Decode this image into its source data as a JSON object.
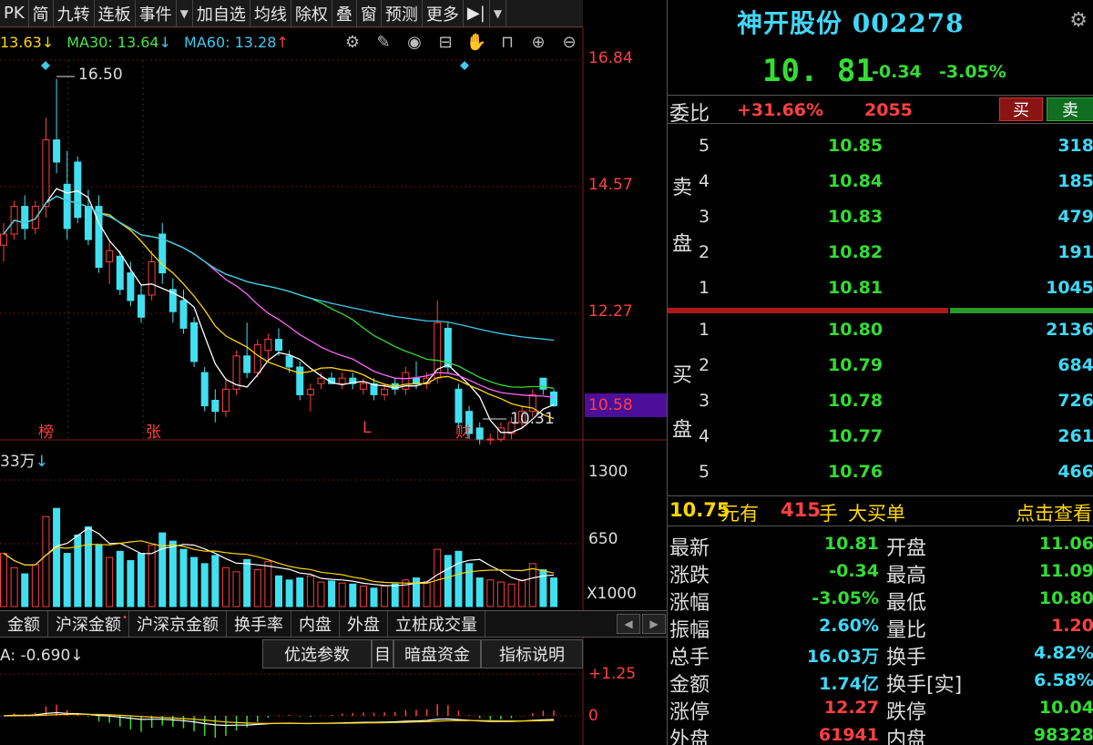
{
  "toolbar": {
    "items": [
      "PK",
      "简",
      "九转",
      "连板",
      "事件",
      "▼",
      "加自选",
      "均线",
      "除权",
      "叠",
      "窗",
      "预测",
      "更多",
      "▶|",
      "▼"
    ]
  },
  "ma": {
    "ma20": "13.63↓",
    "ma30_label": "MA30: 13.64",
    "ma30_arrow": "↓",
    "ma60_label": "MA60: 13.28",
    "ma60_arrow": "↑"
  },
  "chart_tools": [
    "gear-icon",
    "pen-icon",
    "eye-icon",
    "briefcase-icon",
    "hand-icon",
    "lock-icon",
    "plus-icon",
    "minus-icon"
  ],
  "price_axis": [
    "16.84",
    "14.57",
    "12.27"
  ],
  "current_price_tag": "10.58",
  "annotations": {
    "high": "16.50",
    "low": "10.31",
    "marker_bang": "榜",
    "marker_zhang": "张",
    "marker_l": "L",
    "marker_cai": "财"
  },
  "volume": {
    "label": "33万",
    "axis": [
      "1300",
      "650",
      "X1000"
    ]
  },
  "tabs": [
    "金额",
    "沪深金额",
    "沪深京金额",
    "换手率",
    "内盘",
    "外盘",
    "立桩成交量"
  ],
  "macd": {
    "value": "A: -0.690↓",
    "axis_top": "+1.25",
    "axis_zero": "0",
    "buttons": [
      "优选参数",
      "目",
      "暗盘资金",
      "指标说明"
    ]
  },
  "stock": {
    "title": "神开股份  002278",
    "price": "10. 81",
    "change": "-0.34",
    "change_pct": "-3.05%"
  },
  "weibi": {
    "label": "委比",
    "pct": "+31.66%",
    "num": "2055",
    "buy": "买",
    "sell": "卖"
  },
  "side_labels": {
    "sell": [
      "卖",
      "盘"
    ],
    "buy": [
      "买",
      "盘"
    ]
  },
  "asks": [
    {
      "lvl": "5",
      "price": "10.85",
      "vol": "318"
    },
    {
      "lvl": "4",
      "price": "10.84",
      "vol": "185"
    },
    {
      "lvl": "3",
      "price": "10.83",
      "vol": "479"
    },
    {
      "lvl": "2",
      "price": "10.82",
      "vol": "191"
    },
    {
      "lvl": "1",
      "price": "10.81",
      "vol": "1045"
    }
  ],
  "bids": [
    {
      "lvl": "1",
      "price": "10.80",
      "vol": "2136"
    },
    {
      "lvl": "2",
      "price": "10.79",
      "vol": "684"
    },
    {
      "lvl": "3",
      "price": "10.78",
      "vol": "726"
    },
    {
      "lvl": "4",
      "price": "10.77",
      "vol": "261"
    },
    {
      "lvl": "5",
      "price": "10.76",
      "vol": "466"
    }
  ],
  "big_order": {
    "price": "10.75",
    "unit": "元有",
    "qty": "415",
    "unit2": "手",
    "type": "大买单",
    "link": "点击查看"
  },
  "quote": [
    {
      "k1": "最新",
      "v1": "10.81",
      "c1": "green",
      "k2": "开盘",
      "v2": "11.06",
      "c2": "green"
    },
    {
      "k1": "涨跌",
      "v1": "-0.34",
      "c1": "green",
      "k2": "最高",
      "v2": "11.09",
      "c2": "green"
    },
    {
      "k1": "涨幅",
      "v1": "-3.05%",
      "c1": "green",
      "k2": "最低",
      "v2": "10.80",
      "c2": "green"
    },
    {
      "k1": "振幅",
      "v1": "2.60%",
      "c1": "cyan",
      "k2": "量比",
      "v2": "1.20",
      "c2": "red"
    },
    {
      "k1": "总手",
      "v1": "16.03万",
      "c1": "cyan",
      "k2": "换手",
      "v2": "4.82%",
      "c2": "cyan"
    },
    {
      "k1": "金额",
      "v1": "1.74亿",
      "c1": "cyan",
      "k2": "换手[实]",
      "v2": "6.58%",
      "c2": "cyan"
    },
    {
      "k1": "涨停",
      "v1": "12.27",
      "c1": "red",
      "k2": "跌停",
      "v2": "10.04",
      "c2": "green"
    },
    {
      "k1": "外盘",
      "v1": "61941",
      "c1": "red",
      "k2": "内盘",
      "v2": "98328",
      "c2": "green"
    }
  ],
  "colors": {
    "up": "#ff4040",
    "down": "#40e0f0",
    "ma5": "#ffffff",
    "ma10": "#ffd700",
    "ma20": "#ff66ff",
    "ma30": "#33dd33",
    "ma60": "#40c8f0"
  },
  "chart_data": {
    "type": "candlestick",
    "price_axis_ticks": [
      16.84,
      14.57,
      12.27,
      10.58
    ],
    "ohlc": [
      [
        13.5,
        13.9,
        13.2,
        13.7
      ],
      [
        13.7,
        14.3,
        13.6,
        14.2
      ],
      [
        14.2,
        14.4,
        13.6,
        13.8
      ],
      [
        13.8,
        14.3,
        13.7,
        14.2
      ],
      [
        14.2,
        15.8,
        14.0,
        15.4
      ],
      [
        15.4,
        16.5,
        14.8,
        15.0
      ],
      [
        14.6,
        15.2,
        13.6,
        13.8
      ],
      [
        15.0,
        15.1,
        13.9,
        14.0
      ],
      [
        14.2,
        14.5,
        13.5,
        13.6
      ],
      [
        14.2,
        14.4,
        13.0,
        13.1
      ],
      [
        13.2,
        13.6,
        12.8,
        13.4
      ],
      [
        13.3,
        13.4,
        12.6,
        12.7
      ],
      [
        13.0,
        13.2,
        12.4,
        12.5
      ],
      [
        12.6,
        12.8,
        12.1,
        12.2
      ],
      [
        12.6,
        13.4,
        12.5,
        13.2
      ],
      [
        13.7,
        13.9,
        12.8,
        13.0
      ],
      [
        12.7,
        12.9,
        12.1,
        12.3
      ],
      [
        12.5,
        12.7,
        11.9,
        12.0
      ],
      [
        12.1,
        12.2,
        11.3,
        11.4
      ],
      [
        11.2,
        11.3,
        10.5,
        10.6
      ],
      [
        10.7,
        10.9,
        10.3,
        10.5
      ],
      [
        10.5,
        11.1,
        10.4,
        10.9
      ],
      [
        10.9,
        11.6,
        10.8,
        11.5
      ],
      [
        11.5,
        12.1,
        11.1,
        11.2
      ],
      [
        11.2,
        11.8,
        11.1,
        11.7
      ],
      [
        11.6,
        11.9,
        11.4,
        11.8
      ],
      [
        11.8,
        12.0,
        11.5,
        11.6
      ],
      [
        11.5,
        11.6,
        11.2,
        11.3
      ],
      [
        11.3,
        11.4,
        10.7,
        10.8
      ],
      [
        10.8,
        11.0,
        10.5,
        10.9
      ],
      [
        11.0,
        11.2,
        10.9,
        11.1
      ],
      [
        11.1,
        11.2,
        11.0,
        11.0
      ],
      [
        11.0,
        11.2,
        10.9,
        11.1
      ],
      [
        11.1,
        11.2,
        10.9,
        11.0
      ],
      [
        10.9,
        11.1,
        10.8,
        11.0
      ],
      [
        11.0,
        11.1,
        10.7,
        10.8
      ],
      [
        10.8,
        11.0,
        10.7,
        10.9
      ],
      [
        11.0,
        11.1,
        10.8,
        10.9
      ],
      [
        10.9,
        11.3,
        10.8,
        11.2
      ],
      [
        11.1,
        11.4,
        10.9,
        11.0
      ],
      [
        11.0,
        11.2,
        10.9,
        11.1
      ],
      [
        11.1,
        12.5,
        11.0,
        12.1
      ],
      [
        12.0,
        12.1,
        11.2,
        11.3
      ],
      [
        10.9,
        11.0,
        10.2,
        10.3
      ],
      [
        10.5,
        10.6,
        10.0,
        10.1
      ],
      [
        10.2,
        10.3,
        9.9,
        10.0
      ],
      [
        10.0,
        10.1,
        9.9,
        10.0
      ],
      [
        10.0,
        10.3,
        9.95,
        10.2
      ],
      [
        10.1,
        10.4,
        10.0,
        10.3
      ],
      [
        10.3,
        10.6,
        10.2,
        10.5
      ],
      [
        10.5,
        10.9,
        10.4,
        10.8
      ],
      [
        11.1,
        11.1,
        10.8,
        10.9
      ],
      [
        10.85,
        10.9,
        10.58,
        10.6
      ]
    ],
    "volume": [
      520,
      380,
      320,
      410,
      880,
      960,
      520,
      700,
      780,
      600,
      480,
      540,
      450,
      520,
      600,
      720,
      640,
      560,
      480,
      420,
      500,
      380,
      340,
      460,
      360,
      440,
      300,
      260,
      280,
      300,
      240,
      250,
      230,
      220,
      200,
      180,
      200,
      220,
      260,
      280,
      240,
      560,
      500,
      540,
      420,
      280,
      260,
      240,
      220,
      260,
      420,
      360,
      280
    ]
  }
}
